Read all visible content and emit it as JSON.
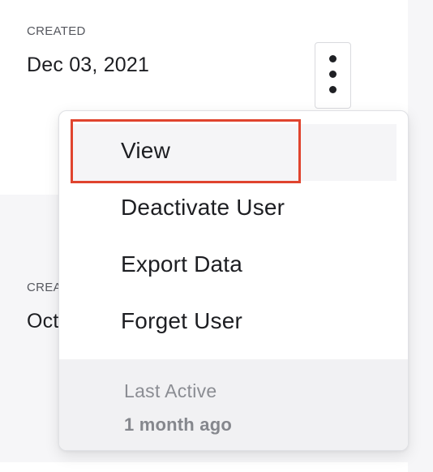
{
  "users": [
    {
      "created_label": "CREATED",
      "created_value": "Dec 03, 2021"
    },
    {
      "created_label": "CREA",
      "created_value": "Oct"
    }
  ],
  "actions_button": {
    "icon": "more-vertical-icon"
  },
  "dropdown": {
    "items": [
      {
        "label": "View",
        "state": "hovered",
        "highlighted": true
      },
      {
        "label": "Deactivate User"
      },
      {
        "label": "Export Data"
      },
      {
        "label": "Forget User"
      }
    ],
    "footer": {
      "label": "Last Active",
      "value": "1 month ago"
    }
  },
  "colors": {
    "highlight_border": "#e0442e",
    "page_background": "#f6f6f8",
    "card_background": "#ffffff",
    "footer_background": "#f1f1f3"
  }
}
